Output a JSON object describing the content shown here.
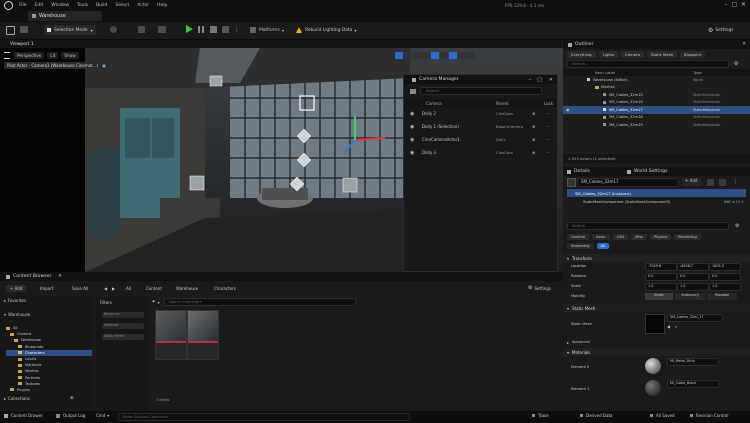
{
  "menubar": {
    "items": [
      "File",
      "Edit",
      "Window",
      "Tools",
      "Build",
      "Select",
      "Actor",
      "Help"
    ],
    "right_text": "FPS 129.8 · 4.1 ms"
  },
  "tabs": {
    "level_tab": "Warehouse"
  },
  "toolbar": {
    "select_mode": "Selection Mode",
    "platforms": "Platforms",
    "build_lighting": "Rebuild Lighting Data",
    "settings": "Settings"
  },
  "viewport": {
    "tab_label": "Viewport 1",
    "perspective": "Perspective",
    "lit": "Lit",
    "show": "Show",
    "camera_info": "Pilot Actor - Camera1 (Warehouse Cinemat...)"
  },
  "camera_manager": {
    "title": "Camera Manager",
    "search_placeholder": "Search",
    "columns": [
      "Camera",
      "Parent",
      "Lock"
    ],
    "rows": [
      {
        "name": "Dolly 2",
        "parent": "CineCam"
      },
      {
        "name": "Dolly 1 (Selection)",
        "parent": "BloomCamera"
      },
      {
        "name": "CineCameraActor1",
        "parent": "Dolly"
      },
      {
        "name": "Dolly 3",
        "parent": "CineCam"
      }
    ]
  },
  "outliner": {
    "title": "Outliner",
    "filters": [
      "Everything",
      "Lights",
      "Camera",
      "Static Mesh",
      "Blueprint"
    ],
    "search_placeholder": "Search...",
    "col_label": "Item Label",
    "col_type": "Type",
    "rows": [
      {
        "label": "Warehouse (Editor)",
        "type": "World"
      },
      {
        "label": "Meshes",
        "type": ""
      },
      {
        "label": "SM_Cables_32m15",
        "type": "StaticMeshActor"
      },
      {
        "label": "SM_Cables_32m16",
        "type": "StaticMeshActor"
      },
      {
        "label": "SM_Cables_32m17",
        "type": "StaticMeshActor"
      },
      {
        "label": "SM_Cables_32m18",
        "type": "StaticMeshActor"
      },
      {
        "label": "SM_Cables_32m19",
        "type": "StaticMeshActor"
      }
    ],
    "footer": "1,553 actors (1 selected)"
  },
  "details": {
    "tab_details": "Details",
    "tab_world": "World Settings",
    "actor_name": "SM_Cables_32m17",
    "add_button": "+ Add",
    "component": "SM_Cables_32m17 (Instance)",
    "subcomponent": "StaticMeshComponent (StaticMeshComponent0)",
    "edit_label": "Edit in C++",
    "search_placeholder": "Search",
    "categories": [
      "General",
      "Actor",
      "LOD",
      "Misc",
      "Physics",
      "Rendering",
      "Streaming",
      "All"
    ],
    "transform_header": "Transform",
    "location_label": "Location",
    "rotation_label": "Rotation",
    "scale_label": "Scale",
    "location": [
      "-7049.6",
      "-8436.7",
      "1605.3"
    ],
    "rotation": [
      "0.0",
      "0.0",
      "0.0"
    ],
    "scale": [
      "1.0",
      "1.0",
      "1.0"
    ],
    "mobility_label": "Mobility",
    "mobility": [
      "Static",
      "Stationary",
      "Movable"
    ],
    "static_mesh_header": "Static Mesh",
    "static_mesh_label": "Static Mesh",
    "static_mesh_value": "SM_Cables_32m_17",
    "advanced_label": "Advanced",
    "materials_header": "Materials",
    "element0_label": "Element 0",
    "element0_value": "MI_Metal_Dirty",
    "element1_label": "Element 1",
    "element1_value": "MI_Cable_Black"
  },
  "content_browser": {
    "tab": "Content Browser",
    "add": "+ Add",
    "import": "Import",
    "save_all": "Save All",
    "breadcrumb": [
      "All",
      "Content",
      "Warehouse",
      "Characters"
    ],
    "settings": "Settings",
    "favorites": "Favorites",
    "project_header": "Warehouse",
    "tree": [
      "All",
      "Content",
      "Warehouse",
      "Blueprints",
      "Characters",
      "Levels",
      "Materials",
      "Meshes",
      "Particles",
      "Textures",
      "Plugins"
    ],
    "collections": "Collections",
    "filters_header": "Filters",
    "filters": [
      "Blueprint",
      "Material",
      "Static Mesh"
    ],
    "search_placeholder": "Search Characters",
    "asset_count": "2 items"
  },
  "statusbar": {
    "content_drawer": "Content Drawer",
    "output_log": "Output Log",
    "cmd": "Cmd",
    "console_placeholder": "Enter Console Command",
    "trace": "Trace",
    "derived_data": "Derived Data",
    "all_saved": "All Saved",
    "revision_control": "Revision Control"
  }
}
